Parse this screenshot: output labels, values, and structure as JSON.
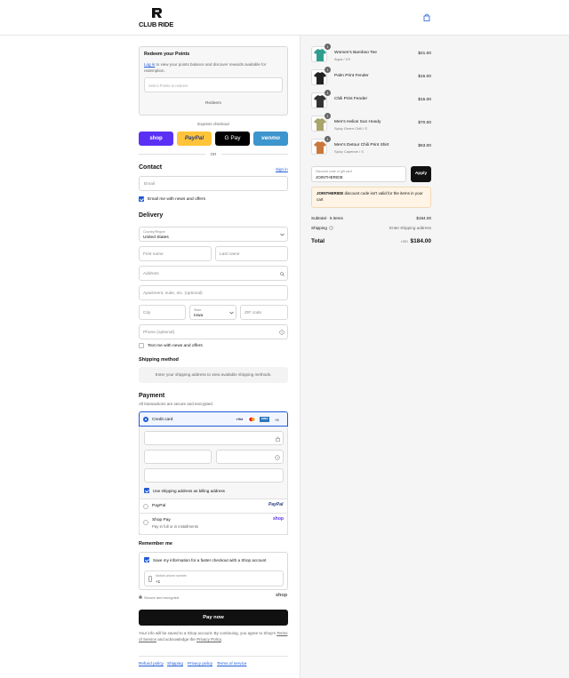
{
  "header": {
    "brand": "CLUB RIDE"
  },
  "redeem": {
    "title": "Redeem your Points",
    "login_link": "Log in",
    "desc": " to view your points balance and discover rewards available for redemption.",
    "select_placeholder": "Select Points to redeem",
    "button": "Redeem"
  },
  "express": {
    "label": "Express checkout",
    "shop": "shop",
    "paypal": "PayPal",
    "gpay": "G Pay",
    "venmo": "venmo",
    "or": "OR"
  },
  "contact": {
    "title": "Contact",
    "signin": "Sign in",
    "email_placeholder": "Email",
    "news_label": "Email me with news and offers"
  },
  "delivery": {
    "title": "Delivery",
    "country_label": "Country/Region",
    "country_value": "United States",
    "first_name": "First name",
    "last_name": "Last name",
    "address": "Address",
    "apartment": "Apartment, suite, etc. (optional)",
    "city": "City",
    "state_label": "State",
    "state_value": "Iowa",
    "zip": "ZIP code",
    "phone": "Phone (optional)",
    "text_label": "Text me with news and offers"
  },
  "shipping_method": {
    "title": "Shipping method",
    "note": "Enter your shipping address to view available shipping methods."
  },
  "payment": {
    "title": "Payment",
    "subtitle": "All transactions are secure and encrypted.",
    "credit_card": "Credit card",
    "visa": "VISA",
    "amex": "AMEX",
    "more_cards": "+5",
    "billing_label": "Use shipping address as billing address",
    "paypal_option": "PayPal",
    "paypal_logo": "PayPal",
    "shoppay_option": "Shop Pay",
    "shoppay_sub": "Pay in full or in installments",
    "shoppay_logo": "shop"
  },
  "remember": {
    "title": "Remember me",
    "save_label": "Save my information for a faster checkout with a Shop account",
    "mobile_label": "Mobile phone number",
    "mobile_value": "+1",
    "secure": "Secure and encrypted",
    "shop_logo": "shop"
  },
  "pay_now": "Pay now",
  "legal": {
    "line1": "Your info will be saved to a Shop account. By continuing, you agree to Shop's",
    "tos": "Terms of Service",
    "mid": " and acknowledge the ",
    "privacy": "Privacy Policy",
    "end": "."
  },
  "footer_links": [
    "Refund policy",
    "Shipping",
    "Privacy policy",
    "Terms of service"
  ],
  "cart": {
    "items": [
      {
        "qty": "1",
        "name": "Women's Bamboo Tee",
        "variant": "Aqua / XS",
        "price": "$21.00",
        "color": "#2f9e8f"
      },
      {
        "qty": "1",
        "name": "Palm Print Fender",
        "variant": "",
        "price": "$15.00",
        "color": "#222222"
      },
      {
        "qty": "1",
        "name": "Chili Print Fender",
        "variant": "",
        "price": "$15.00",
        "color": "#333333"
      },
      {
        "qty": "1",
        "name": "Men's Helios Sun Hoody",
        "variant": "Spicy Green Chili / S",
        "price": "$70.00",
        "color": "#a9a46a"
      },
      {
        "qty": "1",
        "name": "Men's Detour Chili Print Shirt",
        "variant": "Spicy Cayenne / S",
        "price": "$63.00",
        "color": "#c9773a"
      }
    ],
    "discount_label": "Discount code or gift card",
    "discount_value": "JOINTHERIDE",
    "apply": "Apply",
    "error_code": "JOINTHERIDE",
    "error_msg": " discount code isn't valid for the items in your cart",
    "subtotal_label": "Subtotal · 5 items",
    "subtotal_value": "$184.00",
    "shipping_label": "Shipping",
    "shipping_value": "Enter shipping address",
    "total_label": "Total",
    "currency": "USD",
    "total_value": "$184.00"
  }
}
